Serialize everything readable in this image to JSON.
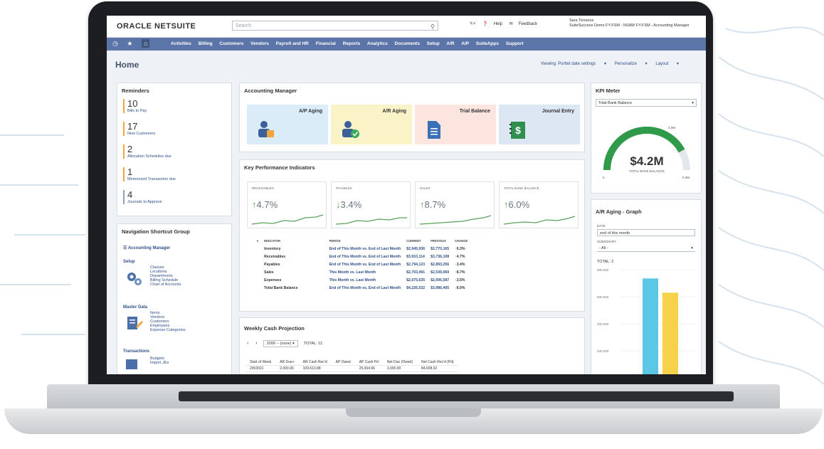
{
  "app": {
    "logo": "ORACLE NETSUITE",
    "search_placeholder": "Search",
    "help": "Help",
    "feedback": "Feedback",
    "user_name": "Sara Torrance",
    "user_role": "SuiteSuccess Demo FY-FSM - NSAW FY-FSM - Accounting Manager"
  },
  "nav": {
    "items": [
      "Activities",
      "Billing",
      "Customers",
      "Vendors",
      "Payroll and HR",
      "Financial",
      "Reports",
      "Analytics",
      "Documents",
      "Setup",
      "A/R",
      "A/P",
      "SuiteApps",
      "Support"
    ]
  },
  "page": {
    "title": "Home",
    "viewing": "Viewing: Portlet date settings",
    "personalize": "Personalize",
    "layout": "Layout"
  },
  "reminders": {
    "title": "Reminders",
    "items": [
      {
        "count": "10",
        "label": "Bills to Pay"
      },
      {
        "count": "17",
        "label": "New Customers"
      },
      {
        "count": "2",
        "label": "Allocation Schedules due"
      },
      {
        "count": "1",
        "label": "Memorized Transaction due"
      },
      {
        "count": "4",
        "label": "Journals to Approve"
      }
    ]
  },
  "nav_shortcuts": {
    "title": "Navigation Shortcut Group",
    "manager": "Accounting Manager",
    "setup": "Setup",
    "setup_links": [
      "Classes",
      "Locations",
      "Departments",
      "Billing Schedule",
      "Chart of Accounts"
    ],
    "master": "Master Data",
    "master_links": [
      "Items",
      "Vendors",
      "Customers",
      "Employees",
      "Expense Categories"
    ],
    "transactions": "Transactions",
    "transaction_links": [
      "Budgets",
      "Import JEs"
    ]
  },
  "accounting_manager": {
    "title": "Accounting Manager",
    "tiles": [
      "A/P Aging",
      "A/R Aging",
      "Trial Balance",
      "Journal Entry"
    ],
    "colors": [
      "#d9ecf7",
      "#fbf3c8",
      "#fbe5de",
      "#dde6f3"
    ]
  },
  "kpi": {
    "title": "Key Performance Indicators",
    "cards": [
      {
        "name": "RECEIVABLES",
        "value": "4.7%",
        "arrow": "↑"
      },
      {
        "name": "PAYABLES",
        "value": "3.4%",
        "arrow": "↓"
      },
      {
        "name": "SALES",
        "value": "8.7%",
        "arrow": "↑"
      },
      {
        "name": "TOTAL BANK BALANCE",
        "value": "6.0%",
        "arrow": "↑"
      }
    ],
    "headers": [
      "INDICATOR",
      "PERIOD",
      "CURRENT",
      "PREVIOUS",
      "CHANGE"
    ],
    "rows": [
      {
        "indicator": "Inventory",
        "period": "End of This Month vs. End of Last Month",
        "current": "$2,945,936",
        "previous": "$2,770,165",
        "change": "6.3%"
      },
      {
        "indicator": "Receivables",
        "period": "End of This Month vs. End of Last Month",
        "current": "$3,910,114",
        "previous": "$3,736,108",
        "change": "4.7%"
      },
      {
        "indicator": "Payables",
        "period": "End of This Month vs. End of Last Month",
        "current": "$2,794,123",
        "previous": "$2,893,256",
        "change": "3.4%"
      },
      {
        "indicator": "Sales",
        "period": "This Month vs. Last Month",
        "current": "$2,703,491",
        "previous": "$2,539,969",
        "change": "8.7%"
      },
      {
        "indicator": "Expenses",
        "period": "This Month vs. Last Month",
        "current": "$2,075,635",
        "previous": "$2,006,587",
        "change": "3.5%"
      },
      {
        "indicator": "Total Bank Balance",
        "period": "End of This Month vs. End of Last Month",
        "current": "$4,226,532",
        "previous": "$3,986,405",
        "change": "6.0%"
      }
    ]
  },
  "weekly": {
    "title": "Weekly Cash Projection",
    "range": "2000 -- (none)",
    "total": "TOTAL: 12",
    "headers": [
      "Start of Week",
      "AR Due+",
      "AR Cash Rec'd",
      "AP Owed",
      "AP Cash Pd",
      "Net Due (Owed)",
      "Net Cash Rec'd (Pd)"
    ],
    "row": [
      "2/8/2021",
      "2,000.00",
      "109,613.88",
      "",
      "25,004.96",
      "2,000.00",
      "84,608.92"
    ]
  },
  "kpi_meter": {
    "title": "KPI Meter",
    "select": "Total Bank Balance",
    "value": "$4.2M",
    "label": "TOTAL BANK BALANCE",
    "min": "0",
    "max": "5.0M",
    "mark": "4.0M",
    "fraction": 0.84
  },
  "ar_graph": {
    "title": "A/R Aging - Graph",
    "date_label": "DATE",
    "date_value": "end of this month",
    "sub_label": "SUBSIDIARY",
    "sub_value": "- All -",
    "total": "TOTAL: 2",
    "y_ticks": [
      "800,000",
      "600,000",
      "400,000",
      "200,000"
    ]
  },
  "chart_data": {
    "type": "bar",
    "categories": [
      "",
      ""
    ],
    "values": [
      735000,
      630000
    ],
    "ylim": [
      0,
      800000
    ]
  }
}
